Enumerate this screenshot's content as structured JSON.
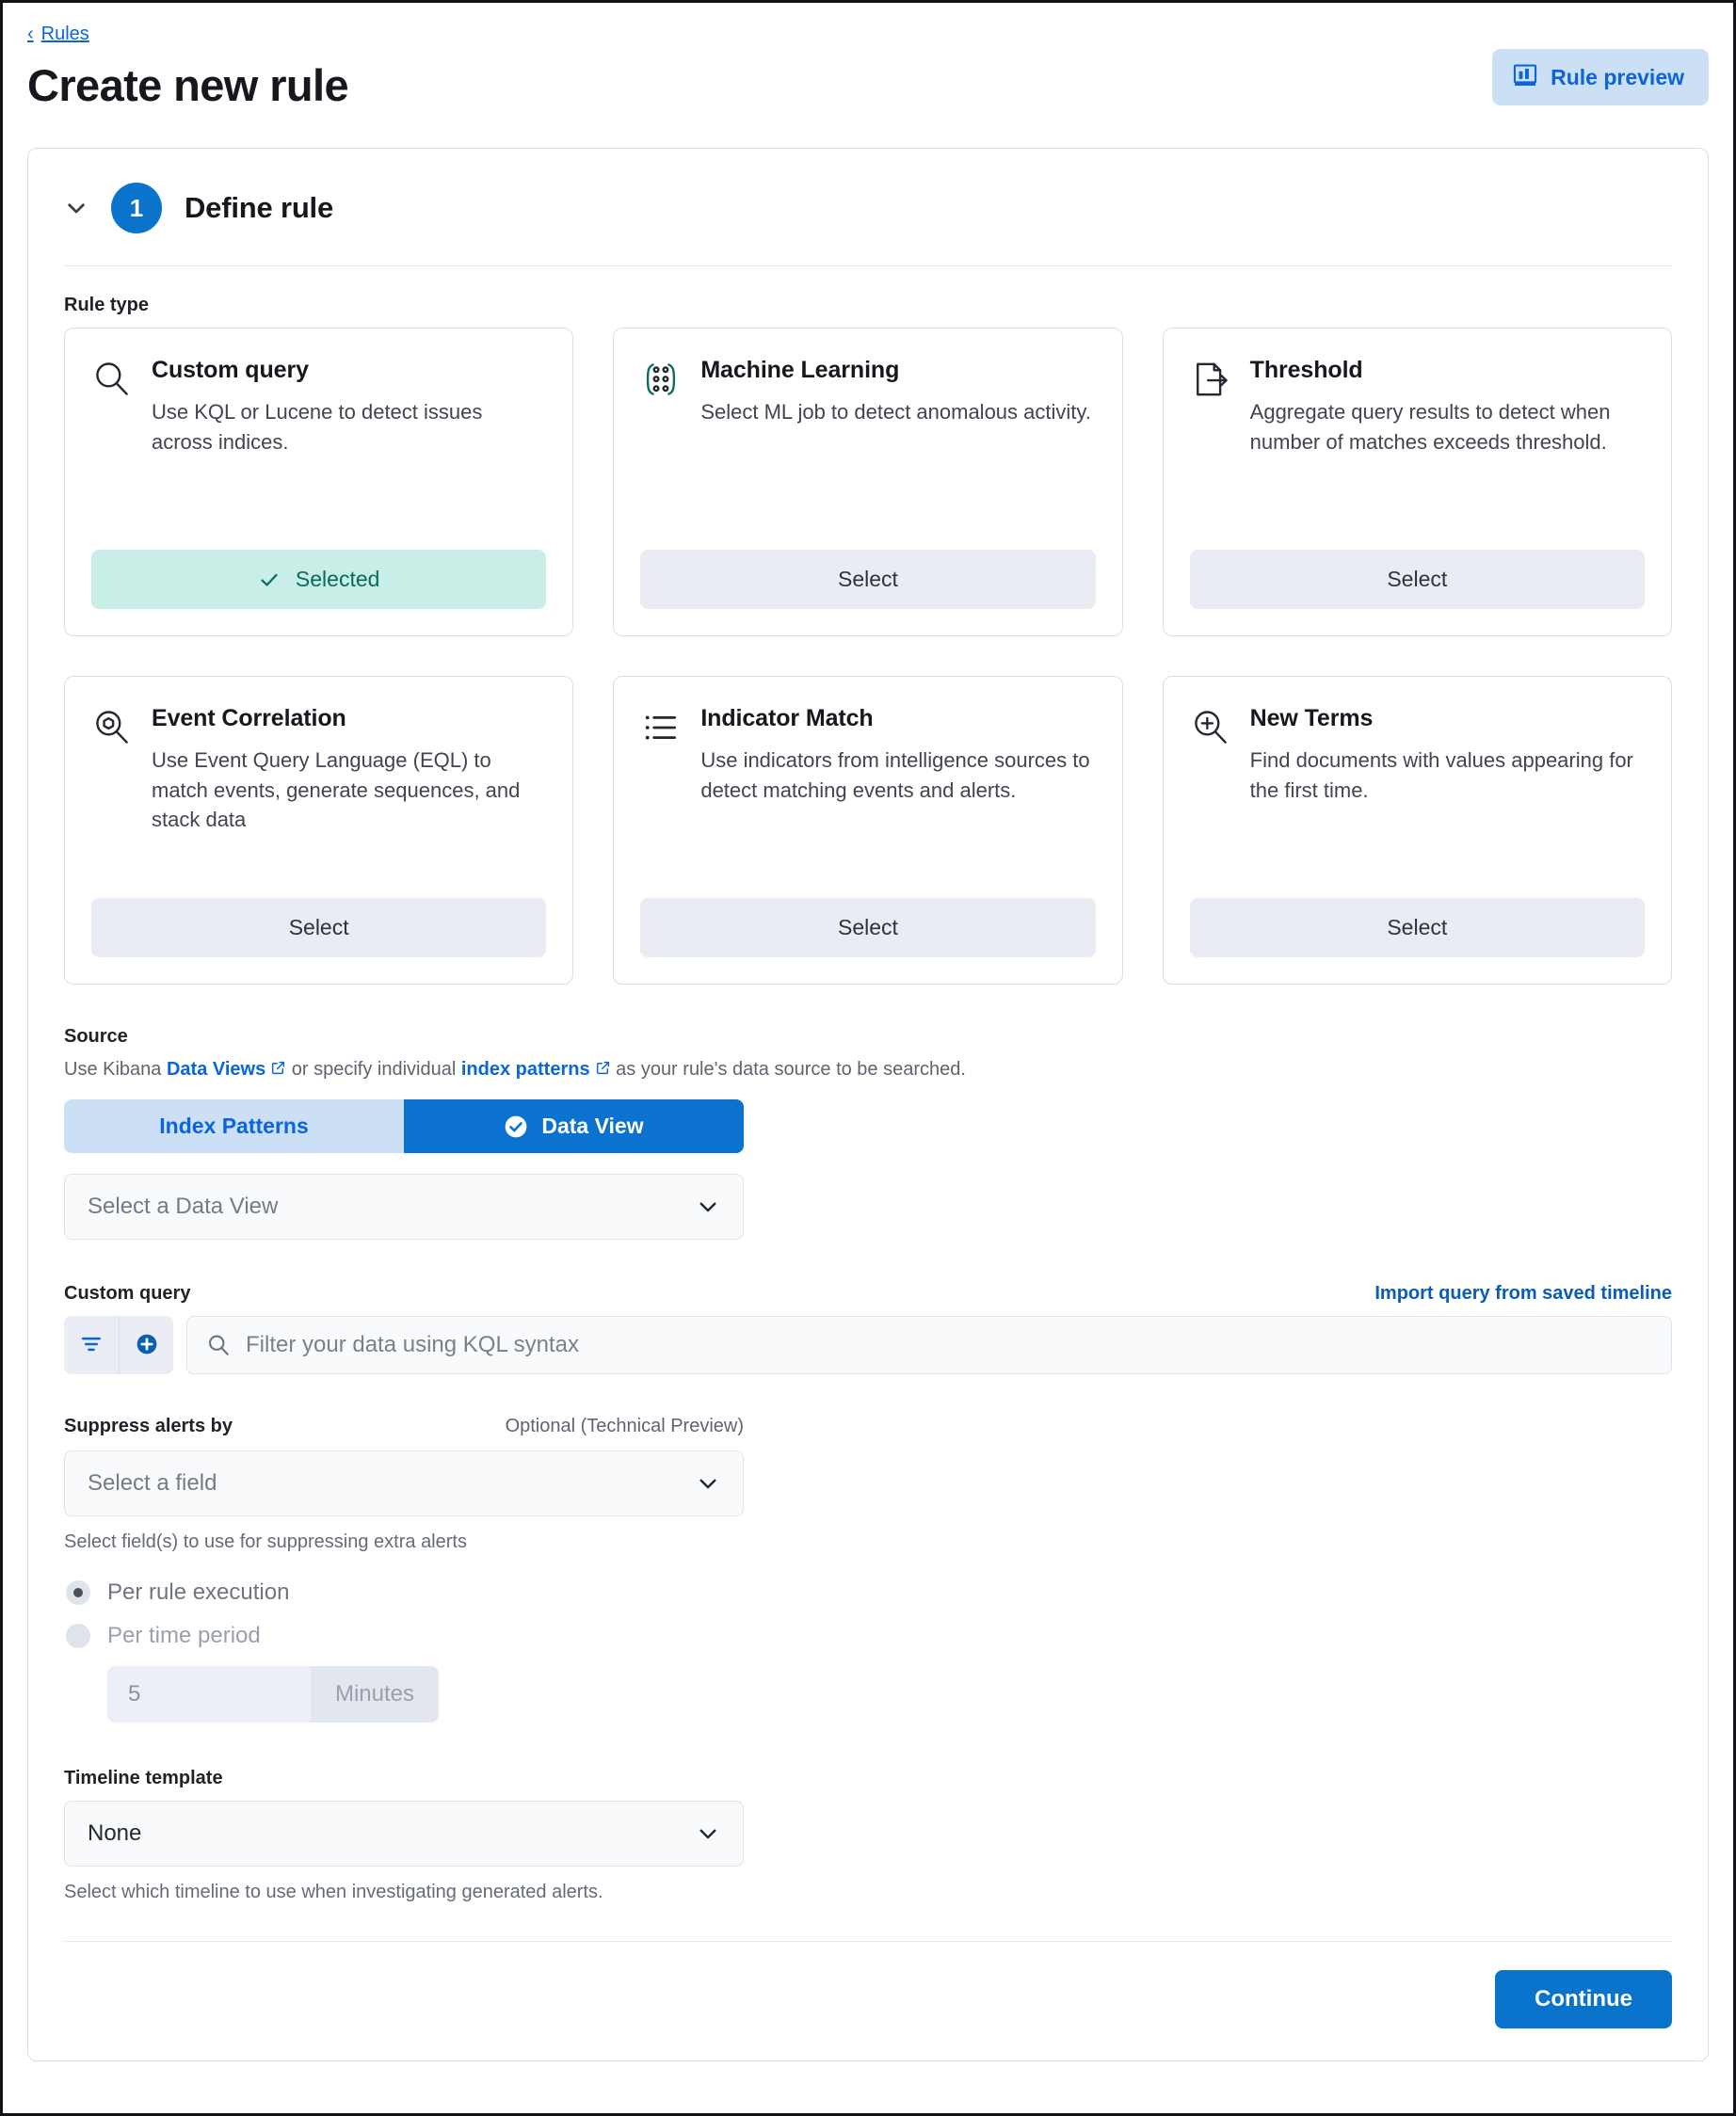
{
  "breadcrumb": {
    "label": "Rules",
    "back_icon": "chevron-left-icon"
  },
  "header": {
    "title": "Create new rule",
    "rule_preview": {
      "label": "Rule preview",
      "icon": "bar-chart-icon"
    }
  },
  "step": {
    "number": "1",
    "title": "Define rule",
    "collapse_icon": "chevron-down-icon"
  },
  "rule_type": {
    "label": "Rule type",
    "cards": [
      {
        "title": "Custom query",
        "desc": "Use KQL or Lucene to detect issues across indices.",
        "icon": "magnifier-icon",
        "button": "Selected",
        "selected": true
      },
      {
        "title": "Machine Learning",
        "desc": "Select ML job to detect anomalous activity.",
        "icon": "machine-learning-icon",
        "button": "Select",
        "selected": false
      },
      {
        "title": "Threshold",
        "desc": "Aggregate query results to detect when number of matches exceeds threshold.",
        "icon": "document-arrow-icon",
        "button": "Select",
        "selected": false
      },
      {
        "title": "Event Correlation",
        "desc": "Use Event Query Language (EQL) to match events, generate sequences, and stack data",
        "icon": "sequence-magnifier-icon",
        "button": "Select",
        "selected": false
      },
      {
        "title": "Indicator Match",
        "desc": "Use indicators from intelligence sources to detect matching events and alerts.",
        "icon": "list-icon",
        "button": "Select",
        "selected": false
      },
      {
        "title": "New Terms",
        "desc": "Find documents with values appearing for the first time.",
        "icon": "magnifier-plus-icon",
        "button": "Select",
        "selected": false
      }
    ]
  },
  "source": {
    "label": "Source",
    "desc_part1": "Use Kibana ",
    "link1": "Data Views",
    "desc_part2": " or specify individual ",
    "link2": "index patterns",
    "desc_part3": " as your rule's data source to be searched.",
    "external_icon": "external-link-icon",
    "toggle": {
      "index_patterns": "Index Patterns",
      "data_view": "Data View",
      "active": "Data View",
      "check_icon": "check-circle-icon"
    },
    "data_view_select": {
      "value": "Select a Data View",
      "chevron_icon": "chevron-down-icon"
    }
  },
  "custom_query": {
    "label": "Custom query",
    "import_link": "Import query from saved timeline",
    "filter_button_icon": "filter-icon",
    "add_filter_button_icon": "plus-circle-icon",
    "search_icon": "search-icon",
    "placeholder": "Filter your data using KQL syntax",
    "value": ""
  },
  "suppress": {
    "label": "Suppress alerts by",
    "optional": "Optional (Technical Preview)",
    "field_select": {
      "value": "Select a field",
      "chevron_icon": "chevron-down-icon"
    },
    "help": "Select field(s) to use for suppressing extra alerts",
    "options": [
      {
        "label": "Per rule execution",
        "checked": true
      },
      {
        "label": "Per time period",
        "checked": false
      }
    ],
    "period_value": "5",
    "period_unit": "Minutes"
  },
  "timeline": {
    "label": "Timeline template",
    "select": {
      "value": "None",
      "chevron_icon": "chevron-down-icon"
    },
    "help": "Select which timeline to use when investigating generated alerts."
  },
  "footer": {
    "continue_label": "Continue"
  },
  "colors": {
    "accent_blue": "#0a73cc",
    "link_blue": "#0b64dd",
    "selected_teal_bg": "#c9eee7",
    "selected_teal_text": "#066b5e",
    "light_blue_bg": "#cce0f5",
    "neutral_btn_bg": "#e9edf3"
  }
}
